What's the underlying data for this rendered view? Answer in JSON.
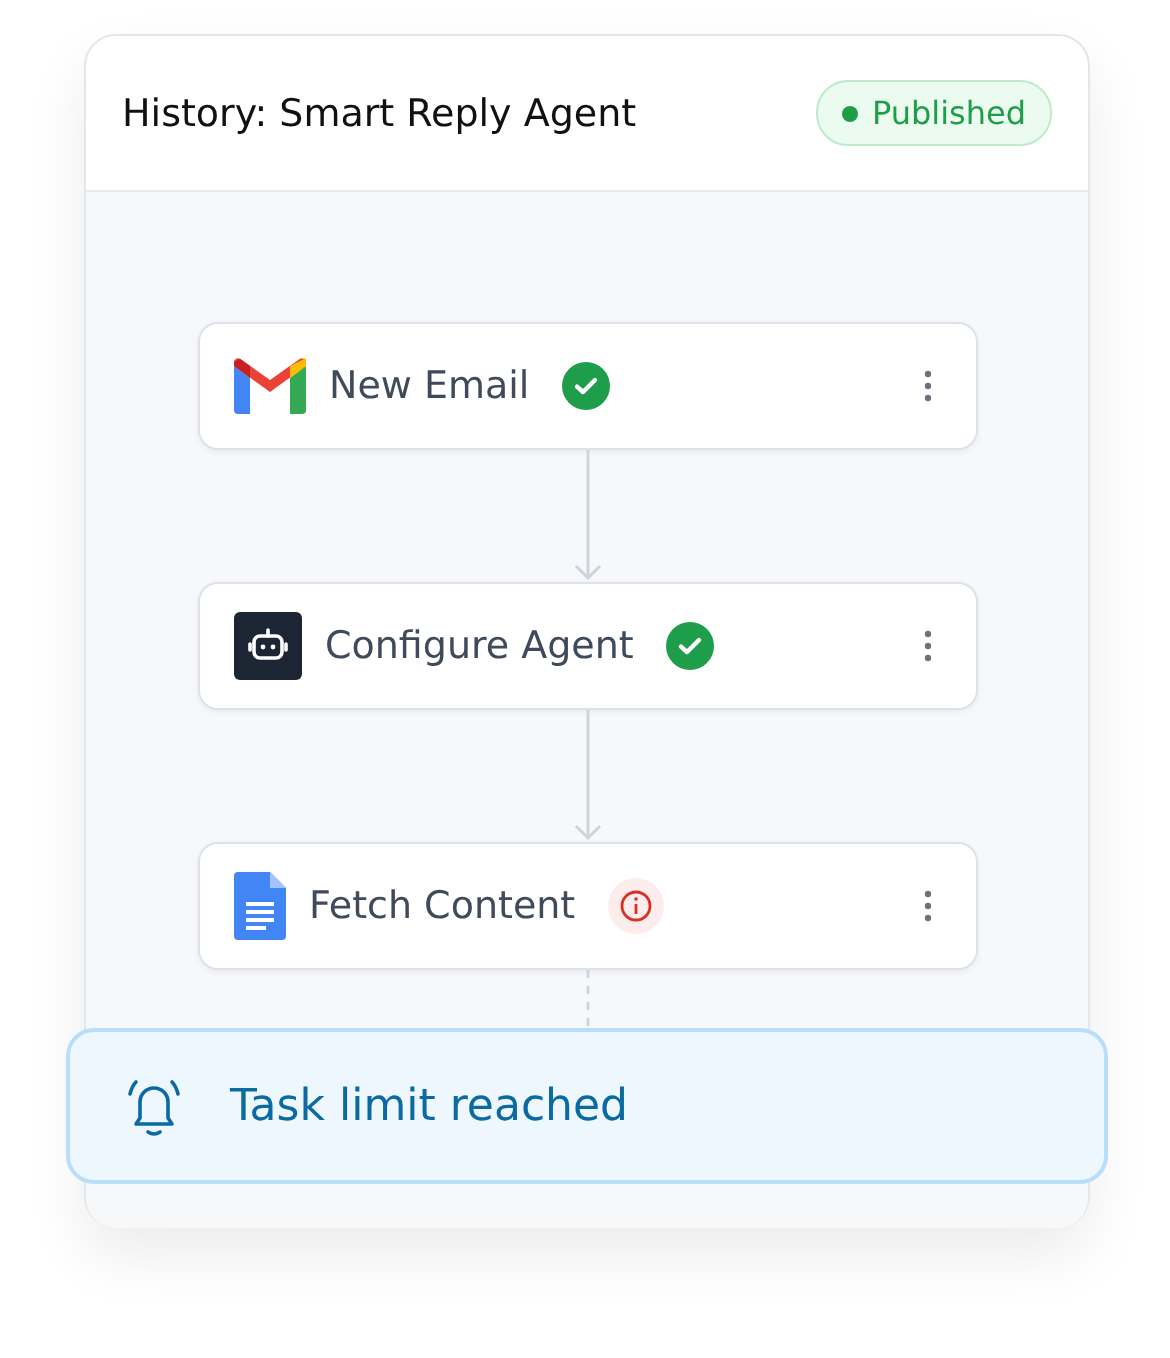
{
  "title": "History: Smart Reply Agent",
  "status": {
    "label": "Published",
    "published": true
  },
  "nodes": [
    {
      "label": "New Email",
      "kind": "mail",
      "error": false
    },
    {
      "label": "Configure Agent",
      "kind": "agent",
      "error": false
    },
    {
      "label": "Fetch Content",
      "kind": "document",
      "error": true
    }
  ],
  "banner": {
    "message": "Task limit reached"
  }
}
